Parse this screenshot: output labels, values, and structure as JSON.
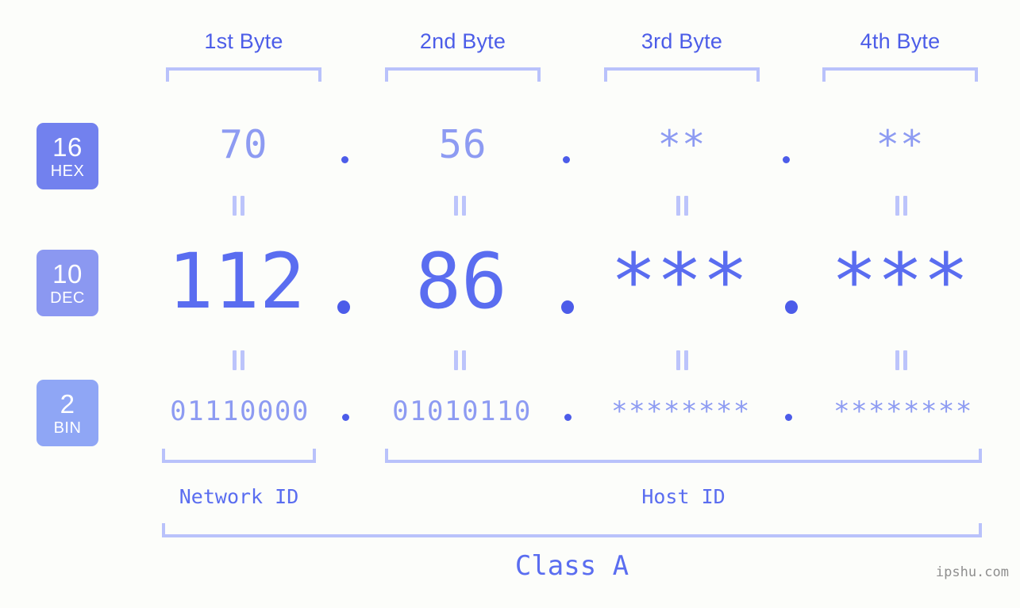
{
  "background_color": "#fcfdfa",
  "accent_colors": {
    "header_blue": "#4c5de8",
    "bracket_blue": "#b9c2fb",
    "value_light": "#8d9bf2",
    "value_strong": "#5a6df0",
    "dot_blue": "#4c5ce9",
    "badge_hex": "#7281ee",
    "badge_dec": "#8b98f1",
    "badge_bin": "#8fa6f5",
    "watermark_gray": "#8f8f8f"
  },
  "byte_headers": [
    {
      "label": "1st Byte"
    },
    {
      "label": "2nd Byte"
    },
    {
      "label": "3rd Byte"
    },
    {
      "label": "4th Byte"
    }
  ],
  "bases": [
    {
      "number": "16",
      "name": "HEX"
    },
    {
      "number": "10",
      "name": "DEC"
    },
    {
      "number": "2",
      "name": "BIN"
    }
  ],
  "rows": {
    "hex": {
      "values": [
        "70",
        "56",
        "**",
        "**"
      ]
    },
    "dec": {
      "values": [
        "112",
        "86",
        "***",
        "***"
      ]
    },
    "bin": {
      "values": [
        "01110000",
        "01010110",
        "********",
        "********"
      ]
    }
  },
  "separator": ".",
  "equality_marks": {
    "glyph": "=",
    "count_per_gap": 4
  },
  "segments": [
    {
      "label": "Network ID"
    },
    {
      "label": "Host ID"
    }
  ],
  "class_label": "Class A",
  "watermark": "ipshu.com"
}
